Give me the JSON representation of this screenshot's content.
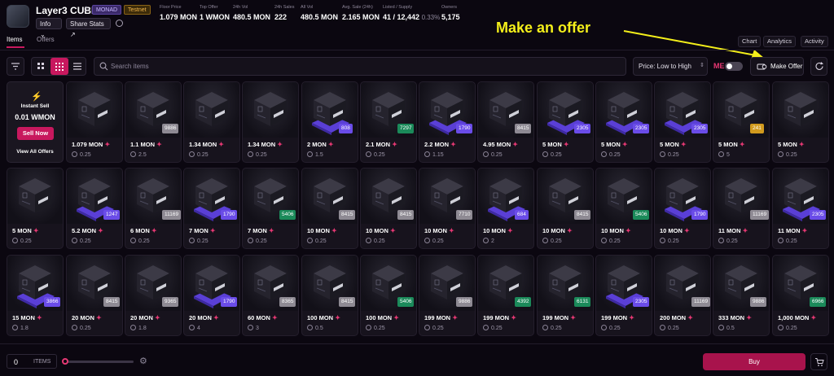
{
  "header": {
    "title": "Layer3 CUBE",
    "tags": [
      "MONAD",
      "Testnet"
    ],
    "info_label": "Info",
    "share_label": "Share Stats",
    "stats": [
      {
        "label": "Floor Price",
        "value": "1.079 MON"
      },
      {
        "label": "Top Offer",
        "value": "1 WMON"
      },
      {
        "label": "24h Vol",
        "value": "480.5 MON"
      },
      {
        "label": "24h Sales",
        "value": "222"
      },
      {
        "label": "All Vol",
        "value": "480.5 MON"
      },
      {
        "label": "Avg. Sale (24h)",
        "value": "2.165 MON"
      },
      {
        "label": "Listed / Supply",
        "value": "41 / 12,442",
        "sub": "0.33%"
      },
      {
        "label": "Owners",
        "value": "5,175"
      }
    ]
  },
  "tabs": [
    {
      "label": "Items"
    },
    {
      "label": "Offers"
    }
  ],
  "right_tabs": [
    "Chart",
    "Analytics",
    "Activity"
  ],
  "annotation": "Make an offer",
  "toolbar": {
    "search_placeholder": "Search items",
    "sort_label": "Price: Low to High",
    "make_offer_label": "Make Offer",
    "me_logo": "ME"
  },
  "instant_sell": {
    "title": "Instant Sell",
    "price": "0.01 WMON",
    "button": "Sell Now",
    "link": "View All Offers"
  },
  "items": [
    {
      "price": "1.079 MON",
      "sub": "0.25",
      "badge": "",
      "badge_color": ""
    },
    {
      "price": "1.1 MON",
      "sub": "2.5",
      "badge": "9886",
      "badge_color": "#8e8a93"
    },
    {
      "price": "1.34 MON",
      "sub": "0.25",
      "badge": "",
      "badge_color": ""
    },
    {
      "price": "1.34 MON",
      "sub": "0.25",
      "badge": "",
      "badge_color": ""
    },
    {
      "price": "2 MON",
      "sub": "1.5",
      "badge": "808",
      "badge_color": "#6a4ce8"
    },
    {
      "price": "2.1 MON",
      "sub": "0.25",
      "badge": "7297",
      "badge_color": "#1b8a5a"
    },
    {
      "price": "2.2 MON",
      "sub": "1.15",
      "badge": "1790",
      "badge_color": "#6a4ce8"
    },
    {
      "price": "4.95 MON",
      "sub": "0.25",
      "badge": "8415",
      "badge_color": "#8e8a93"
    },
    {
      "price": "5 MON",
      "sub": "0.25",
      "badge": "2305",
      "badge_color": "#6a4ce8"
    },
    {
      "price": "5 MON",
      "sub": "0.25",
      "badge": "2305",
      "badge_color": "#6a4ce8"
    },
    {
      "price": "5 MON",
      "sub": "0.25",
      "badge": "2305",
      "badge_color": "#6a4ce8"
    },
    {
      "price": "5 MON",
      "sub": "5",
      "badge": "241",
      "badge_color": "#d19a1e"
    },
    {
      "price": "5 MON",
      "sub": "0.25",
      "badge": "",
      "badge_color": ""
    },
    {
      "price": "5 MON",
      "sub": "0.25",
      "badge": "",
      "badge_color": ""
    },
    {
      "price": "5.2 MON",
      "sub": "0.25",
      "badge": "1247",
      "badge_color": "#6a4ce8"
    },
    {
      "price": "6 MON",
      "sub": "0.25",
      "badge": "11169",
      "badge_color": "#8e8a93"
    },
    {
      "price": "7 MON",
      "sub": "0.25",
      "badge": "1790",
      "badge_color": "#6a4ce8"
    },
    {
      "price": "7 MON",
      "sub": "0.25",
      "badge": "5406",
      "badge_color": "#1b8a5a"
    },
    {
      "price": "10 MON",
      "sub": "0.25",
      "badge": "8415",
      "badge_color": "#8e8a93"
    },
    {
      "price": "10 MON",
      "sub": "0.25",
      "badge": "8415",
      "badge_color": "#8e8a93"
    },
    {
      "price": "10 MON",
      "sub": "0.25",
      "badge": "7710",
      "badge_color": "#8e8a93"
    },
    {
      "price": "10 MON",
      "sub": "2",
      "badge": "684",
      "badge_color": "#6a4ce8"
    },
    {
      "price": "10 MON",
      "sub": "0.25",
      "badge": "8415",
      "badge_color": "#8e8a93"
    },
    {
      "price": "10 MON",
      "sub": "0.25",
      "badge": "5406",
      "badge_color": "#1b8a5a"
    },
    {
      "price": "10 MON",
      "sub": "0.25",
      "badge": "1790",
      "badge_color": "#6a4ce8"
    },
    {
      "price": "11 MON",
      "sub": "0.25",
      "badge": "11169",
      "badge_color": "#8e8a93"
    },
    {
      "price": "11 MON",
      "sub": "0.25",
      "badge": "2305",
      "badge_color": "#6a4ce8"
    },
    {
      "price": "15 MON",
      "sub": "1.8",
      "badge": "3866",
      "badge_color": "#6a4ce8"
    },
    {
      "price": "20 MON",
      "sub": "0.25",
      "badge": "8415",
      "badge_color": "#8e8a93"
    },
    {
      "price": "20 MON",
      "sub": "1.8",
      "badge": "9365",
      "badge_color": "#8e8a93"
    },
    {
      "price": "20 MON",
      "sub": "4",
      "badge": "1790",
      "badge_color": "#6a4ce8"
    },
    {
      "price": "60 MON",
      "sub": "3",
      "badge": "8365",
      "badge_color": "#8e8a93"
    },
    {
      "price": "100 MON",
      "sub": "0.5",
      "badge": "8415",
      "badge_color": "#8e8a93"
    },
    {
      "price": "100 MON",
      "sub": "0.25",
      "badge": "5406",
      "badge_color": "#1b8a5a"
    },
    {
      "price": "199 MON",
      "sub": "0.25",
      "badge": "9886",
      "badge_color": "#8e8a93"
    },
    {
      "price": "199 MON",
      "sub": "0.25",
      "badge": "4392",
      "badge_color": "#1b8a5a"
    },
    {
      "price": "199 MON",
      "sub": "0.25",
      "badge": "6131",
      "badge_color": "#1b8a5a"
    },
    {
      "price": "199 MON",
      "sub": "0.25",
      "badge": "2305",
      "badge_color": "#6a4ce8"
    },
    {
      "price": "200 MON",
      "sub": "0.25",
      "badge": "11169",
      "badge_color": "#8e8a93"
    },
    {
      "price": "333 MON",
      "sub": "0.5",
      "badge": "9886",
      "badge_color": "#8e8a93"
    },
    {
      "price": "1,000 MON",
      "sub": "0.25",
      "badge": "6966",
      "badge_color": "#1b8a5a"
    }
  ],
  "footer": {
    "count": "0",
    "items_label": "ITEMS",
    "buy_label": "Buy"
  }
}
